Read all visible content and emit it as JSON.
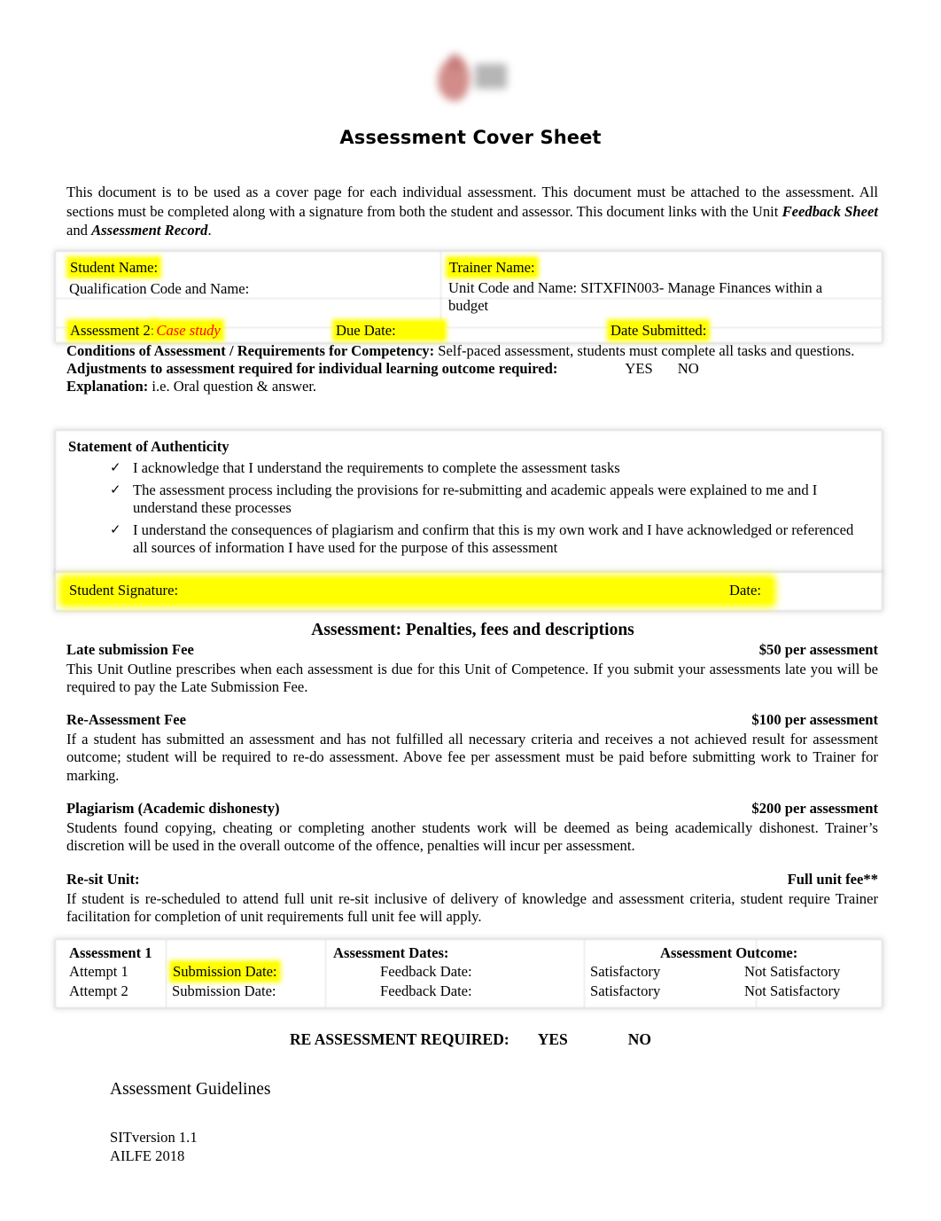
{
  "document": {
    "title": "Assessment Cover Sheet",
    "logo_alt": "institute-logo",
    "intro_part1": "This document is to be used as a cover page for each individual assessment. This document must be attached to the assessment.  All sections must be completed along with a signature from both the student and assessor. This document links with the Unit ",
    "intro_em1": "Feedback Sheet",
    "intro_part2": " and ",
    "intro_em2": "Assessment Record",
    "intro_part3": "."
  },
  "info_table": {
    "student_name_label": "Student Name:",
    "trainer_name_label": "Trainer Name:",
    "qualification_label": "Qualification Code and Name:",
    "unit_label": "Unit Code and Name: SITXFIN003- Manage Finances within a budget",
    "assessment_label": "Assessment 2:",
    "assessment_value": "Case study",
    "due_date_label": "Due Date:",
    "date_submitted_label": "Date Submitted:"
  },
  "conditions": {
    "conditions_label": "Conditions of Assessment / Requirements for Competency:",
    "conditions_text": " Self-paced assessment, students must complete all tasks and questions.",
    "adjustments_label": "Adjustments to assessment required for individual learning outcome required:",
    "adjustments_yes": "YES",
    "adjustments_no": "NO",
    "explanation_label": "Explanation:",
    "explanation_text": " i.e. Oral question & answer."
  },
  "authenticity": {
    "heading": "Statement of Authenticity",
    "tick_glyph": "✓",
    "items": [
      "I acknowledge that I understand the requirements to complete the assessment tasks",
      "The assessment process including the provisions for re-submitting and academic appeals were explained to me and I understand these processes",
      "I understand the consequences of plagiarism and confirm that this is my own work and I have acknowledged or referenced all sources of information I have used for the purpose of this assessment"
    ]
  },
  "signature": {
    "student_signature_label": "Student Signature:",
    "date_label": "Date:"
  },
  "penalties": {
    "section_title": "Assessment: Penalties, fees and descriptions",
    "items": [
      {
        "heading": "Late submission Fee",
        "fee": "$50 per assessment",
        "body": "This Unit Outline prescribes when each assessment is due for this Unit of Competence.  If you submit your assessments late you will be required to pay the Late Submission Fee."
      },
      {
        "heading": "Re-Assessment Fee",
        "fee": "$100 per assessment",
        "body": "If a student has submitted an assessment and has not fulfilled all necessary criteria and receives a not achieved result for assessment outcome; student will be required to re-do assessment. Above fee per assessment must be paid before submitting work to Trainer for marking."
      },
      {
        "heading": "Plagiarism (Academic dishonesty)",
        "fee": "$200 per assessment",
        "body": "Students found copying, cheating or completing another students work will be deemed as being academically dishonest. Trainer’s discretion will be used in the overall outcome of the offence, penalties will incur per assessment."
      },
      {
        "heading": "Re-sit Unit:",
        "fee": "Full unit fee**",
        "body": "If student is re-scheduled to attend full unit re-sit inclusive of delivery of knowledge and assessment criteria, student require Trainer facilitation for completion of unit requirements full unit fee will apply."
      }
    ]
  },
  "results_table": {
    "col_assessment": "Assessment 1",
    "col_dates": "Assessment Dates:",
    "col_outcome": "Assessment Outcome:",
    "rows": [
      {
        "attempt": "Attempt 1",
        "submission_date": "Submission Date:",
        "feedback_date": "Feedback Date:",
        "satisfactory": "Satisfactory",
        "not_satisfactory": "Not Satisfactory"
      },
      {
        "attempt": "Attempt 2",
        "submission_date": "Submission Date:",
        "feedback_date": "Feedback Date:",
        "satisfactory": "Satisfactory",
        "not_satisfactory": "Not Satisfactory"
      }
    ]
  },
  "reassessment": {
    "label": "RE ASSESSMENT REQUIRED:",
    "yes": "YES",
    "no": "NO"
  },
  "footer": {
    "guidelines_heading": "Assessment Guidelines",
    "version": "SITversion 1.1",
    "org_year": "AILFE 2018"
  },
  "colors": {
    "highlight": "#ffff00",
    "accent_red": "#ff0000",
    "text": "#000000"
  }
}
